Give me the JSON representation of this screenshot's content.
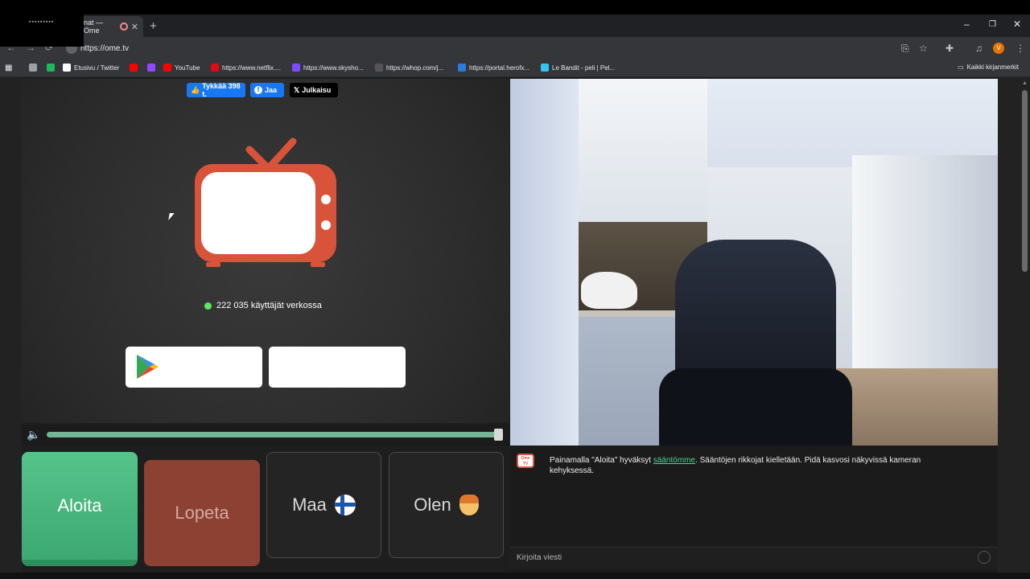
{
  "browser": {
    "tab_title": "nat — Ome",
    "tab_close": "✕",
    "new_tab": "+",
    "url": "https://ome.tv",
    "profile_initial": "V",
    "win_min": "–",
    "win_max": "❐",
    "win_close": "✕",
    "back": "←",
    "forward": "→",
    "reload": "⟳",
    "menu": "⋮"
  },
  "bookmarks": [
    {
      "label": "",
      "icon": "globe-icon",
      "color": "#9aa0a6"
    },
    {
      "label": "",
      "icon": "spotify-icon",
      "color": "#1db954"
    },
    {
      "label": "Etusivu / Twitter",
      "icon": "x-icon",
      "color": "#ffffff"
    },
    {
      "label": "",
      "icon": "youtube-icon",
      "color": "#ff0000"
    },
    {
      "label": "",
      "icon": "twitch-icon",
      "color": "#9146ff"
    },
    {
      "label": "YouTube",
      "icon": "youtube-icon",
      "color": "#ff0000"
    },
    {
      "label": "https://www.netflix....",
      "icon": "netflix-icon",
      "color": "#e50914"
    },
    {
      "label": "https://www.skysho...",
      "icon": "skyshowtime-icon",
      "color": "#7b4dff"
    },
    {
      "label": "https://whop.com/j...",
      "icon": "whop-icon",
      "color": "#555555"
    },
    {
      "label": "https://portal.herofx...",
      "icon": "herofx-icon",
      "color": "#2b7bdd"
    },
    {
      "label": "Le Bandit - peli | Pel...",
      "icon": "bandit-icon",
      "color": "#35c5f0"
    }
  ],
  "all_bookmarks": "Kaikki kirjanmerkit",
  "social": {
    "like": "Tykkää 398 t.",
    "share": "Jaa",
    "post": "Julkaisu"
  },
  "online": {
    "text": "222 035 käyttäjät verkossa"
  },
  "volume": {
    "level": 1.0
  },
  "controls": {
    "start": "Aloita",
    "stop": "Lopeta",
    "country": "Maa",
    "gender": "Olen"
  },
  "chat": {
    "logo": "Ome TV",
    "message_pre": "Painamalla \"Aloita\" hyväksyt ",
    "rules_link": "sääntömme",
    "message_post": ". Sääntöjen rikkojat kielletään. Pidä kasvosi näkyvissä kameran kehyksessä.",
    "placeholder": "Kirjoita viesti"
  },
  "colors": {
    "start_green": "#4dbb82",
    "stop_red": "#8c4132",
    "tv_red": "#d9533a",
    "link_green": "#4fd09a"
  }
}
